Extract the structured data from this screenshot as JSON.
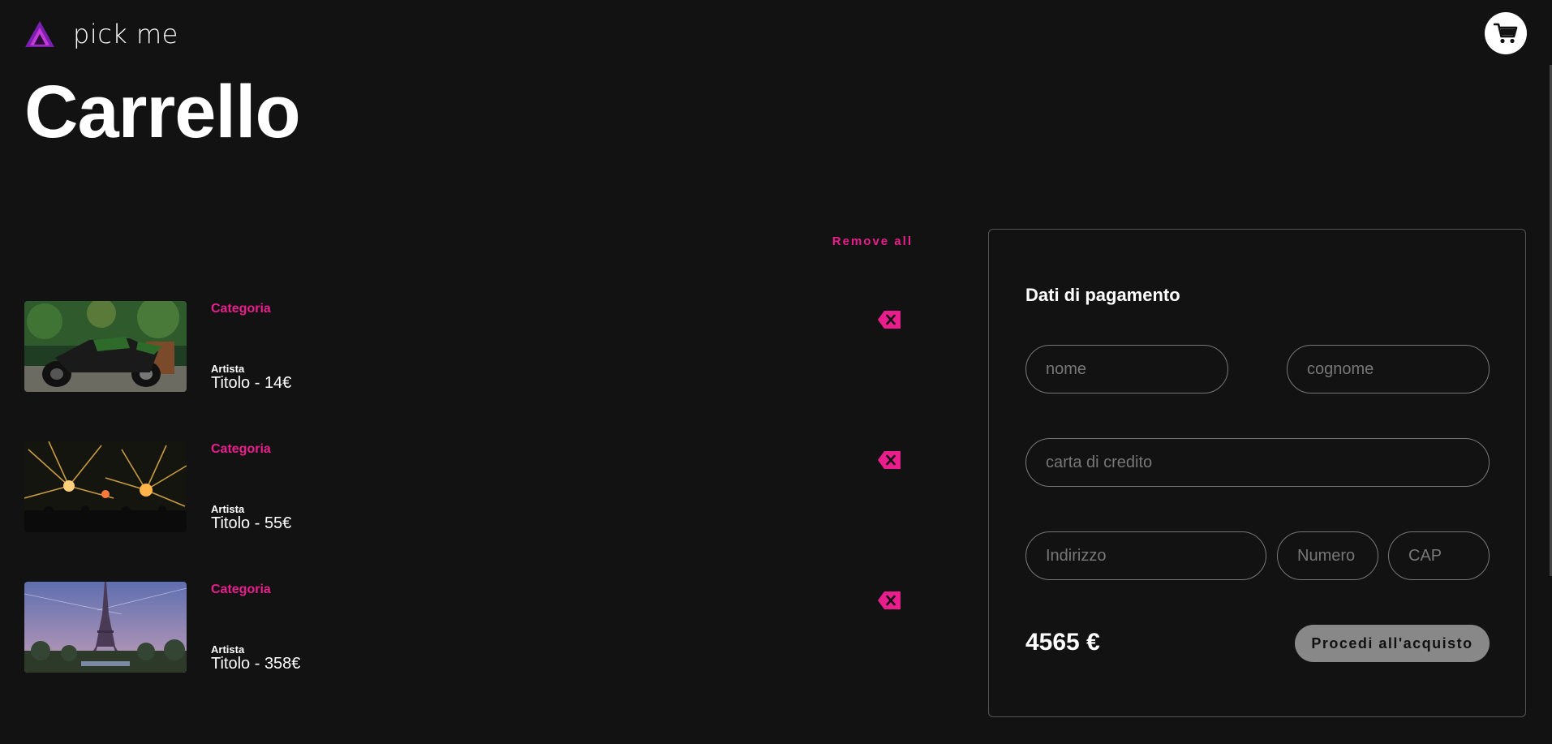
{
  "brand": {
    "name": "pick me",
    "accent": "#e91e8c"
  },
  "header": {
    "cart_icon": "cart-icon"
  },
  "page": {
    "title": "Carrello"
  },
  "cart": {
    "remove_all_label": "Remove all",
    "items": [
      {
        "category": "Categoria",
        "artist": "Artista",
        "title": "Titolo - 14€",
        "image": "motorcycle-photo"
      },
      {
        "category": "Categoria",
        "artist": "Artista",
        "title": "Titolo - 55€",
        "image": "concert-lights-photo"
      },
      {
        "category": "Categoria",
        "artist": "Artista",
        "title": "Titolo - 358€",
        "image": "eiffel-tower-photo"
      }
    ],
    "remove_icon": "backspace-icon"
  },
  "payment": {
    "title": "Dati di pagamento",
    "fields": {
      "nome": {
        "placeholder": "nome",
        "value": ""
      },
      "cognome": {
        "placeholder": "cognome",
        "value": ""
      },
      "carta": {
        "placeholder": "carta di credito",
        "value": ""
      },
      "indirizzo": {
        "placeholder": "Indirizzo",
        "value": ""
      },
      "numero": {
        "placeholder": "Numero",
        "value": ""
      },
      "cap": {
        "placeholder": "CAP",
        "value": ""
      }
    },
    "total": "4565 €",
    "buy_label": "Procedi all'acquisto"
  }
}
